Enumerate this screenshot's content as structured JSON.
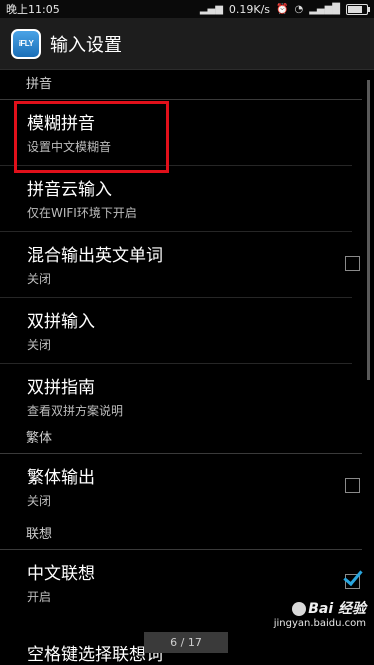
{
  "status_bar": {
    "time": "晚上11:05",
    "network_speed": "0.19K/s",
    "battery_level": 0.85
  },
  "action_bar": {
    "app_icon_text": "iFLY",
    "title": "输入设置"
  },
  "sections": [
    {
      "header": "拼音",
      "items": [
        {
          "title": "模糊拼音",
          "summary": "设置中文模糊音"
        },
        {
          "title": "拼音云输入",
          "summary": "仅在WIFI环境下开启"
        },
        {
          "title": "混合输出英文单词",
          "summary": "关闭",
          "checkbox": false
        },
        {
          "title": "双拼输入",
          "summary": "关闭"
        },
        {
          "title": "双拼指南",
          "summary": "查看双拼方案说明"
        }
      ]
    },
    {
      "header": "繁体",
      "items": [
        {
          "title": "繁体输出",
          "summary": "关闭",
          "checkbox": false
        }
      ]
    },
    {
      "header": "联想",
      "items": [
        {
          "title": "中文联想",
          "summary": "开启",
          "checkbox": true
        },
        {
          "title": "空格键选择联想词"
        }
      ]
    }
  ],
  "pager": {
    "text": "6 / 17"
  },
  "watermark": {
    "line1": "Bai 经验",
    "line2": "jingyan.baidu.com"
  }
}
